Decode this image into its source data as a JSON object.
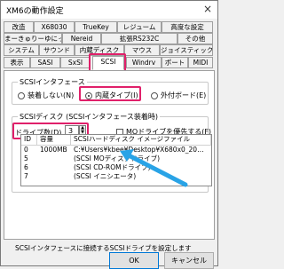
{
  "window": {
    "title": "XM6の動作設定",
    "close_glyph": "×"
  },
  "tabs": {
    "row1": [
      "改造",
      "X68030",
      "TrueKey",
      "レジューム",
      "高度な設定"
    ],
    "row2": [
      "まーきゅりーゆにっと",
      "Nereid",
      "拡張RS232C",
      "その他"
    ],
    "row3": [
      "システム",
      "サウンド",
      "内蔵ディスク",
      "マウス",
      "ジョイスティック"
    ],
    "row4": [
      "表示",
      "SASI",
      "SxSI",
      "SCSI",
      "Windrv",
      "ポート",
      "MIDI"
    ],
    "active": "SCSI"
  },
  "scsi_interface": {
    "legend": "SCSIインタフェース",
    "options": [
      "装着しない(N)",
      "内蔵タイプ(I)",
      "外付ボード(E)"
    ],
    "selected": "内蔵タイプ(I)"
  },
  "scsi_disk": {
    "legend": "SCSIディスク (SCSIインタフェース装着時)",
    "drive_count_label": "ドライブ数(D)",
    "drive_count_value": "3",
    "mo_priority_label": "MOドライブを優先する(F)",
    "mo_priority_checked": false,
    "columns": [
      "ID",
      "容量",
      "SCSIハードディスク イメージファイル"
    ],
    "rows": [
      [
        "0",
        "1000MB",
        "C:¥Users¥kbee¥Desktop¥X680x0_20…"
      ],
      [
        "5",
        "",
        "(SCSI MOディスクドライブ)"
      ],
      [
        "6",
        "",
        "(SCSI CD-ROMドライブ)"
      ],
      [
        "7",
        "",
        "(SCSI イニシエータ)"
      ]
    ]
  },
  "status_text": "SCSIインタフェースに接続するSCSIドライブを設定します",
  "buttons": {
    "ok": "OK",
    "cancel": "キャンセル"
  },
  "colors": {
    "highlight": "#e0206a",
    "arrow": "#29a3e6",
    "default_button_border": "#0078d7"
  }
}
